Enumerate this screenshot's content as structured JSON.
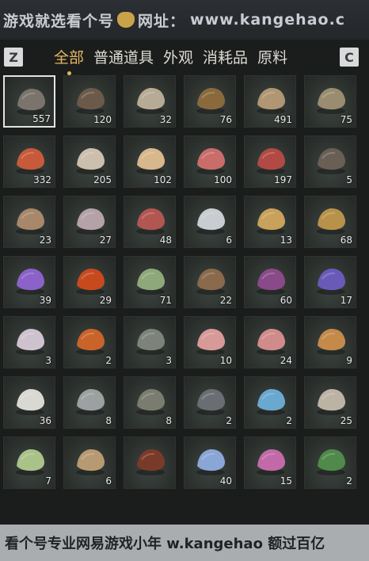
{
  "watermark_top": {
    "site_name": "游戏就选看个号",
    "url_label": "网址：",
    "url": "www.kangehao.c"
  },
  "tabs_bar": {
    "left_key": "Z",
    "right_key": "C",
    "tabs": [
      {
        "label": "全部",
        "active": true
      },
      {
        "label": "普通道具",
        "active": false
      },
      {
        "label": "外观",
        "active": false
      },
      {
        "label": "消耗品",
        "active": false
      },
      {
        "label": "原料",
        "active": false
      }
    ]
  },
  "items": [
    {
      "icon": "ore-rock-icon",
      "count": "557",
      "color": "#7a746c"
    },
    {
      "icon": "feather-icon",
      "count": "120",
      "color": "#6b5a4a"
    },
    {
      "icon": "oysters-icon",
      "count": "32",
      "color": "#b8ab95"
    },
    {
      "icon": "crayfish-icon",
      "count": "76",
      "color": "#8a6a3c"
    },
    {
      "icon": "grain-sack-icon",
      "count": "491",
      "color": "#b09672"
    },
    {
      "icon": "fish-icon",
      "count": "75",
      "color": "#9a8c70"
    },
    {
      "icon": "berries-icon",
      "count": "332",
      "color": "#c65a3a"
    },
    {
      "icon": "mushrooms-icon",
      "count": "205",
      "color": "#cdbfae"
    },
    {
      "icon": "eggs-icon",
      "count": "102",
      "color": "#d7b88c"
    },
    {
      "icon": "meat-chunks-icon",
      "count": "100",
      "color": "#c96d6a"
    },
    {
      "icon": "meat-steak-icon",
      "count": "197",
      "color": "#b14a45"
    },
    {
      "icon": "feathers-icon",
      "count": "5",
      "color": "#6a5f55"
    },
    {
      "icon": "hide-leather-icon",
      "count": "23",
      "color": "#a8876a"
    },
    {
      "icon": "intestine-icon",
      "count": "27",
      "color": "#b4a2a8"
    },
    {
      "icon": "marbled-meat-icon",
      "count": "48",
      "color": "#b25652"
    },
    {
      "icon": "salmon-icon",
      "count": "6",
      "color": "#c9ccd0"
    },
    {
      "icon": "carp-icon",
      "count": "13",
      "color": "#c8a15a"
    },
    {
      "icon": "gold-ore-icon",
      "count": "68",
      "color": "#b8924a"
    },
    {
      "icon": "amethyst-icon",
      "count": "39",
      "color": "#8a62c8"
    },
    {
      "icon": "agate-stone-icon",
      "count": "29",
      "color": "#c74a1e"
    },
    {
      "icon": "herb-plant-icon",
      "count": "71",
      "color": "#8fa87a"
    },
    {
      "icon": "spice-bowl-icon",
      "count": "22",
      "color": "#8a6a4c"
    },
    {
      "icon": "purple-flower-icon",
      "count": "60",
      "color": "#8a4a8a"
    },
    {
      "icon": "lavender-icon",
      "count": "17",
      "color": "#6a5ab8"
    },
    {
      "icon": "white-blossom-icon",
      "count": "3",
      "color": "#cfc2cf"
    },
    {
      "icon": "red-flower-icon",
      "count": "2",
      "color": "#c8642a"
    },
    {
      "icon": "dry-grass-icon",
      "count": "3",
      "color": "#7d827a"
    },
    {
      "icon": "fish-fillet-icon",
      "count": "10",
      "color": "#d79a98"
    },
    {
      "icon": "sliced-meat-icon",
      "count": "24",
      "color": "#d08c8a"
    },
    {
      "icon": "fungus-icon",
      "count": "9",
      "color": "#c48a4a"
    },
    {
      "icon": "cotton-icon",
      "count": "36",
      "color": "#dad8d2"
    },
    {
      "icon": "small-fish-icon",
      "count": "8",
      "color": "#9ca0a0"
    },
    {
      "icon": "catfish-icon",
      "count": "8",
      "color": "#7a7c70"
    },
    {
      "icon": "dark-stone-icon",
      "count": "2",
      "color": "#6a6e72"
    },
    {
      "icon": "blue-crystal-icon",
      "count": "2",
      "color": "#6aa8d0"
    },
    {
      "icon": "bone-icon",
      "count": "25",
      "color": "#bdb3a4"
    },
    {
      "icon": "melon-icon",
      "count": "7",
      "color": "#a9c28a"
    },
    {
      "icon": "rice-bags-icon",
      "count": "6",
      "color": "#b89a72"
    },
    {
      "icon": "red-twig-icon",
      "count": "",
      "color": "#7a3a2a"
    },
    {
      "icon": "blue-flowers-icon",
      "count": "40",
      "color": "#8aa6d6"
    },
    {
      "icon": "pink-flowers-icon",
      "count": "15",
      "color": "#c26aa8"
    },
    {
      "icon": "green-herb-icon",
      "count": "2",
      "color": "#4f8a4a"
    }
  ],
  "watermark_bottom": {
    "text": "看个号专业网易游戏小年 w.kangehao 额过百亿"
  }
}
